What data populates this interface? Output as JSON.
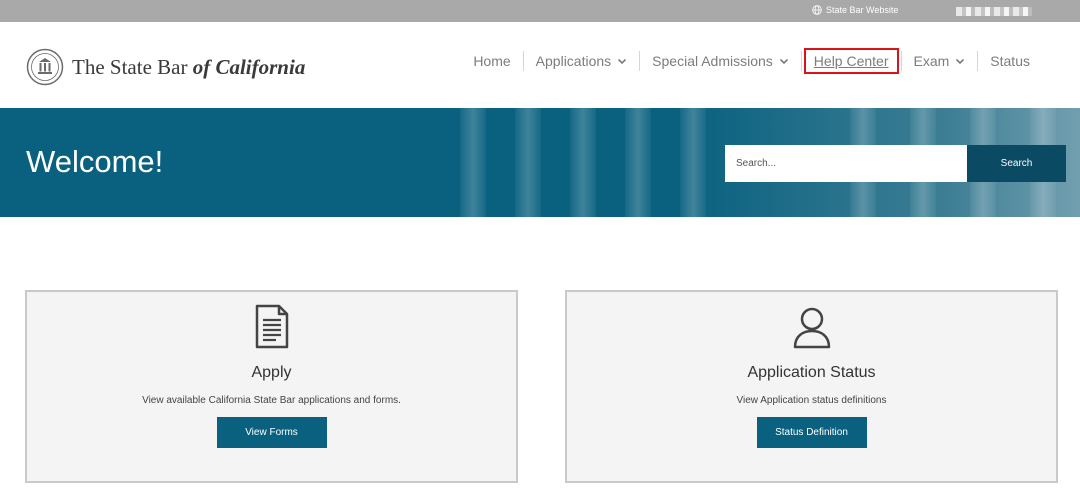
{
  "topbar": {
    "site_link": "State Bar Website"
  },
  "logo": {
    "text_regular": "The State Bar ",
    "text_italic": "of California"
  },
  "nav": {
    "items": [
      {
        "label": "Home"
      },
      {
        "label": "Applications"
      },
      {
        "label": "Special Admissions"
      },
      {
        "label": "Help Center"
      },
      {
        "label": "Exam"
      },
      {
        "label": "Status"
      }
    ]
  },
  "hero": {
    "title": "Welcome!",
    "search_placeholder": "Search...",
    "search_button": "Search"
  },
  "cards": [
    {
      "icon": "document-icon",
      "title": "Apply",
      "description": "View available California State Bar applications and forms.",
      "button": "View Forms"
    },
    {
      "icon": "user-icon",
      "title": "Application Status",
      "description": "View Application status definitions",
      "button": "Status Definition"
    }
  ],
  "colors": {
    "brand_teal": "#09617f",
    "search_button": "#0a4a62",
    "highlight_red": "#d9141a",
    "topbar_gray": "#a9a9a9"
  }
}
